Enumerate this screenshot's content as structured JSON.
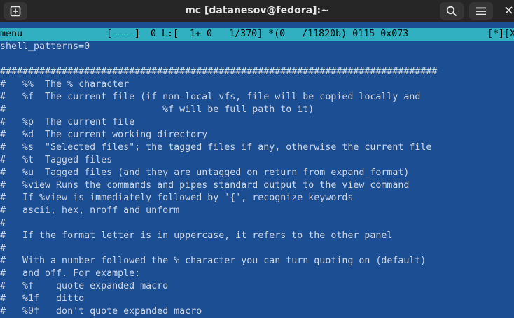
{
  "window": {
    "title": "mc [datanesov@fedora]:~",
    "new_tab_icon": "new-tab-icon",
    "search_icon": "search-icon",
    "menu_icon": "hamburger-menu-icon",
    "close_icon": "close-icon"
  },
  "editor": {
    "status": {
      "filename": "menu",
      "flags": "[----]",
      "position": "0 L:[  1+ 0   1/370] *(0   /11820b) 0115 0x073",
      "right": "[*][X"
    },
    "lines": [
      "shell_patterns=0",
      "",
      "##############################################################################",
      "#   %%  The % character",
      "#   %f  The current file (if non-local vfs, file will be copied locally and",
      "#                            %f will be full path to it)",
      "#   %p  The current file",
      "#   %d  The current working directory",
      "#   %s  \"Selected files\"; the tagged files if any, otherwise the current file",
      "#   %t  Tagged files",
      "#   %u  Tagged files (and they are untagged on return from expand_format)",
      "#   %view Runs the commands and pipes standard output to the view command",
      "#   If %view is immediately followed by '{', recognize keywords",
      "#   ascii, hex, nroff and unform",
      "#",
      "#   If the format letter is in uppercase, it refers to the other panel",
      "#",
      "#   With a number followed the % character you can turn quoting on (default)",
      "#   and off. For example:",
      "#   %f    quote expanded macro",
      "#   %1f   ditto",
      "#   %0f   don't quote expanded macro"
    ]
  }
}
